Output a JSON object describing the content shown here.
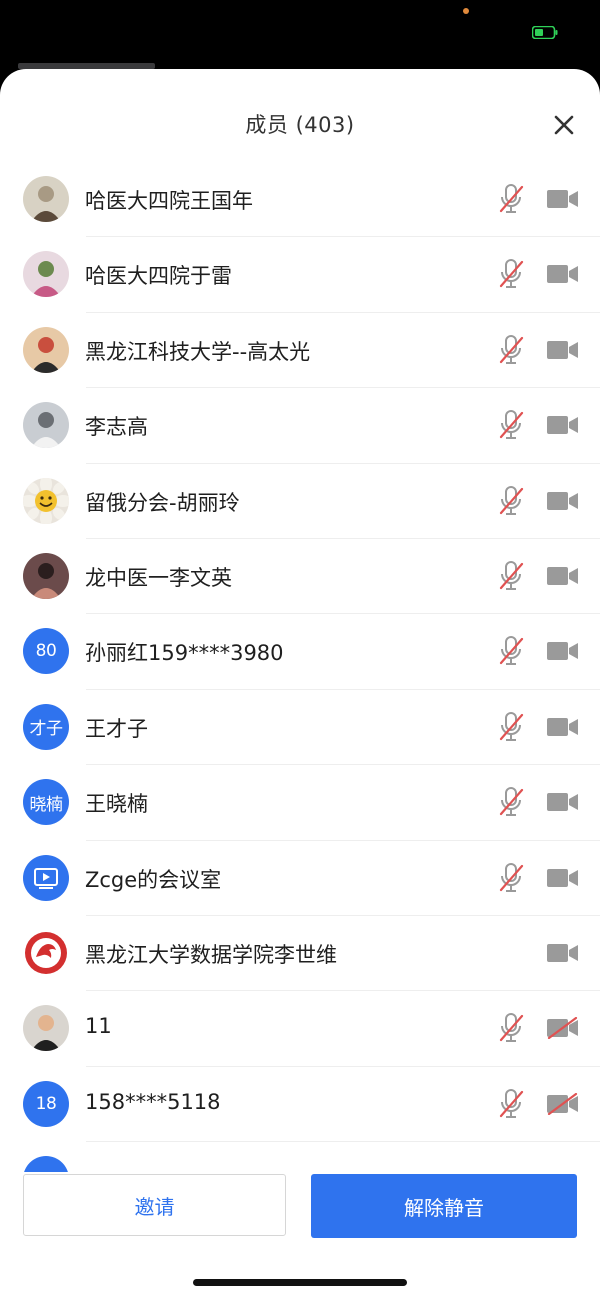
{
  "header": {
    "title": "成员 (403)"
  },
  "members": [
    {
      "name": "哈医大四院王国年",
      "avatar": {
        "type": "photo",
        "palette": [
          "#d8d2c4",
          "#5b4a3a",
          "#a89a84"
        ]
      },
      "mic_muted": true,
      "show_mic": true,
      "cam_off": false
    },
    {
      "name": "哈医大四院于雷",
      "avatar": {
        "type": "photo",
        "palette": [
          "#e8d9e0",
          "#c75a86",
          "#6c8a4f"
        ]
      },
      "mic_muted": true,
      "show_mic": true,
      "cam_off": false
    },
    {
      "name": "黑龙江科技大学--高太光",
      "avatar": {
        "type": "photo",
        "palette": [
          "#e7c9a6",
          "#2b2b2b",
          "#c94f3e"
        ]
      },
      "mic_muted": true,
      "show_mic": true,
      "cam_off": false
    },
    {
      "name": "李志高",
      "avatar": {
        "type": "photo",
        "palette": [
          "#c9cdd2",
          "#f2f2f2",
          "#6b6f74"
        ]
      },
      "mic_muted": true,
      "show_mic": true,
      "cam_off": false
    },
    {
      "name": "留俄分会-胡丽玲",
      "avatar": {
        "type": "smiley"
      },
      "mic_muted": true,
      "show_mic": true,
      "cam_off": false
    },
    {
      "name": "龙中医一李文英",
      "avatar": {
        "type": "photo",
        "palette": [
          "#6b4b4b",
          "#c98a7a",
          "#2b1e1e"
        ]
      },
      "mic_muted": true,
      "show_mic": true,
      "cam_off": false
    },
    {
      "name": "孙丽红159****3980",
      "avatar": {
        "type": "text",
        "text": "80"
      },
      "mic_muted": true,
      "show_mic": true,
      "cam_off": false
    },
    {
      "name": "王才子",
      "avatar": {
        "type": "text",
        "text": "才子"
      },
      "mic_muted": true,
      "show_mic": true,
      "cam_off": false
    },
    {
      "name": "王晓楠",
      "avatar": {
        "type": "text",
        "text": "晓楠"
      },
      "mic_muted": true,
      "show_mic": true,
      "cam_off": false
    },
    {
      "name": "Zcge的会议室",
      "avatar": {
        "type": "room"
      },
      "mic_muted": true,
      "show_mic": true,
      "cam_off": false
    },
    {
      "name": "黑龙江大学数据学院李世维",
      "avatar": {
        "type": "logo"
      },
      "mic_muted": false,
      "show_mic": false,
      "cam_off": false
    },
    {
      "name": "11",
      "avatar": {
        "type": "photo",
        "palette": [
          "#d9d5cf",
          "#1f1f1f",
          "#e3b48f"
        ]
      },
      "mic_muted": true,
      "show_mic": true,
      "cam_off": true
    },
    {
      "name": "158****5118",
      "avatar": {
        "type": "text",
        "text": "18"
      },
      "mic_muted": true,
      "show_mic": true,
      "cam_off": true
    }
  ],
  "footer": {
    "invite_label": "邀请",
    "unmute_all_label": "解除静音"
  },
  "colors": {
    "accent": "#2f73ee",
    "muted_slash": "#e05252",
    "icon_gray": "#9a9a9a"
  }
}
